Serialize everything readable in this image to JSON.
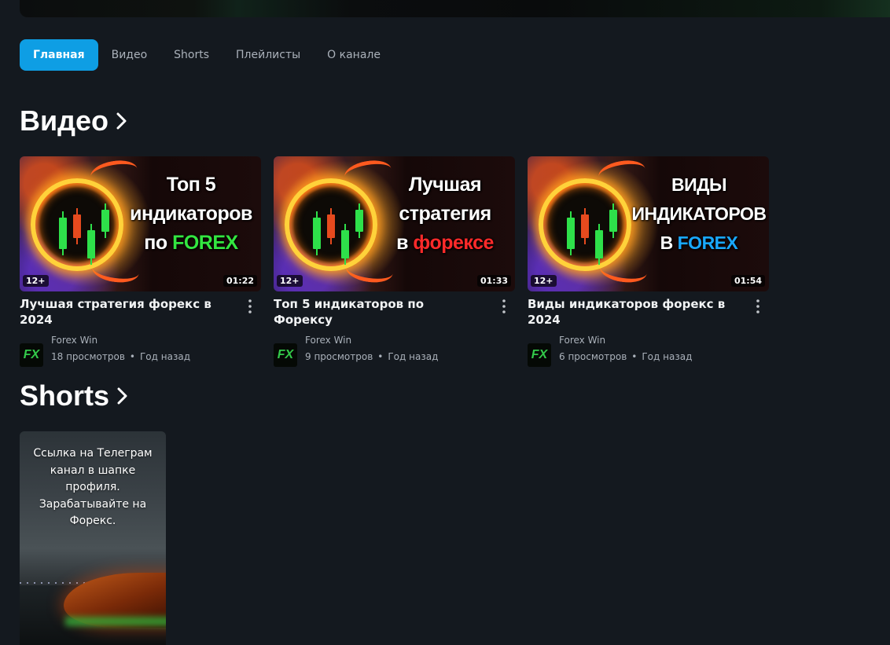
{
  "tabs": [
    {
      "label": "Главная",
      "active": true
    },
    {
      "label": "Видео",
      "active": false
    },
    {
      "label": "Shorts",
      "active": false
    },
    {
      "label": "Плейлисты",
      "active": false
    },
    {
      "label": "О канале",
      "active": false
    }
  ],
  "sections": {
    "videos_title": "Видео",
    "shorts_title": "Shorts"
  },
  "videos": [
    {
      "thumb_lines": [
        "Топ 5",
        "индикаторов",
        "по ",
        "FOREX"
      ],
      "age_rating": "12+",
      "duration": "01:22",
      "title": "Лучшая стратегия форекс в 2024",
      "channel": "Forex Win",
      "views": "18 просмотров",
      "date": "Год назад"
    },
    {
      "thumb_lines": [
        "Лучшая",
        "стратегия",
        "в ",
        "форексе"
      ],
      "age_rating": "12+",
      "duration": "01:33",
      "title": "Топ 5 индикаторов по Форексу",
      "channel": "Forex Win",
      "views": "9 просмотров",
      "date": "Год назад"
    },
    {
      "thumb_lines": [
        "ВИДЫ",
        "ИНДИКАТОРОВ",
        "В ",
        "FOREX"
      ],
      "age_rating": "12+",
      "duration": "01:54",
      "title": "Виды индикаторов форекс в 2024",
      "channel": "Forex Win",
      "views": "6 просмотров",
      "date": "Год назад"
    }
  ],
  "avatar_text": "FX",
  "separator": "•",
  "short": {
    "text": "Ссылка на Телеграм канал в шапке профиля. Зарабатывайте на Форекс."
  },
  "colors": {
    "accent": "#0e9ee4",
    "background": "#14191f",
    "text_secondary": "#aab1ba"
  },
  "icons": [
    "chevron-right-icon",
    "more-vert-icon",
    "channel-avatar-icon"
  ]
}
